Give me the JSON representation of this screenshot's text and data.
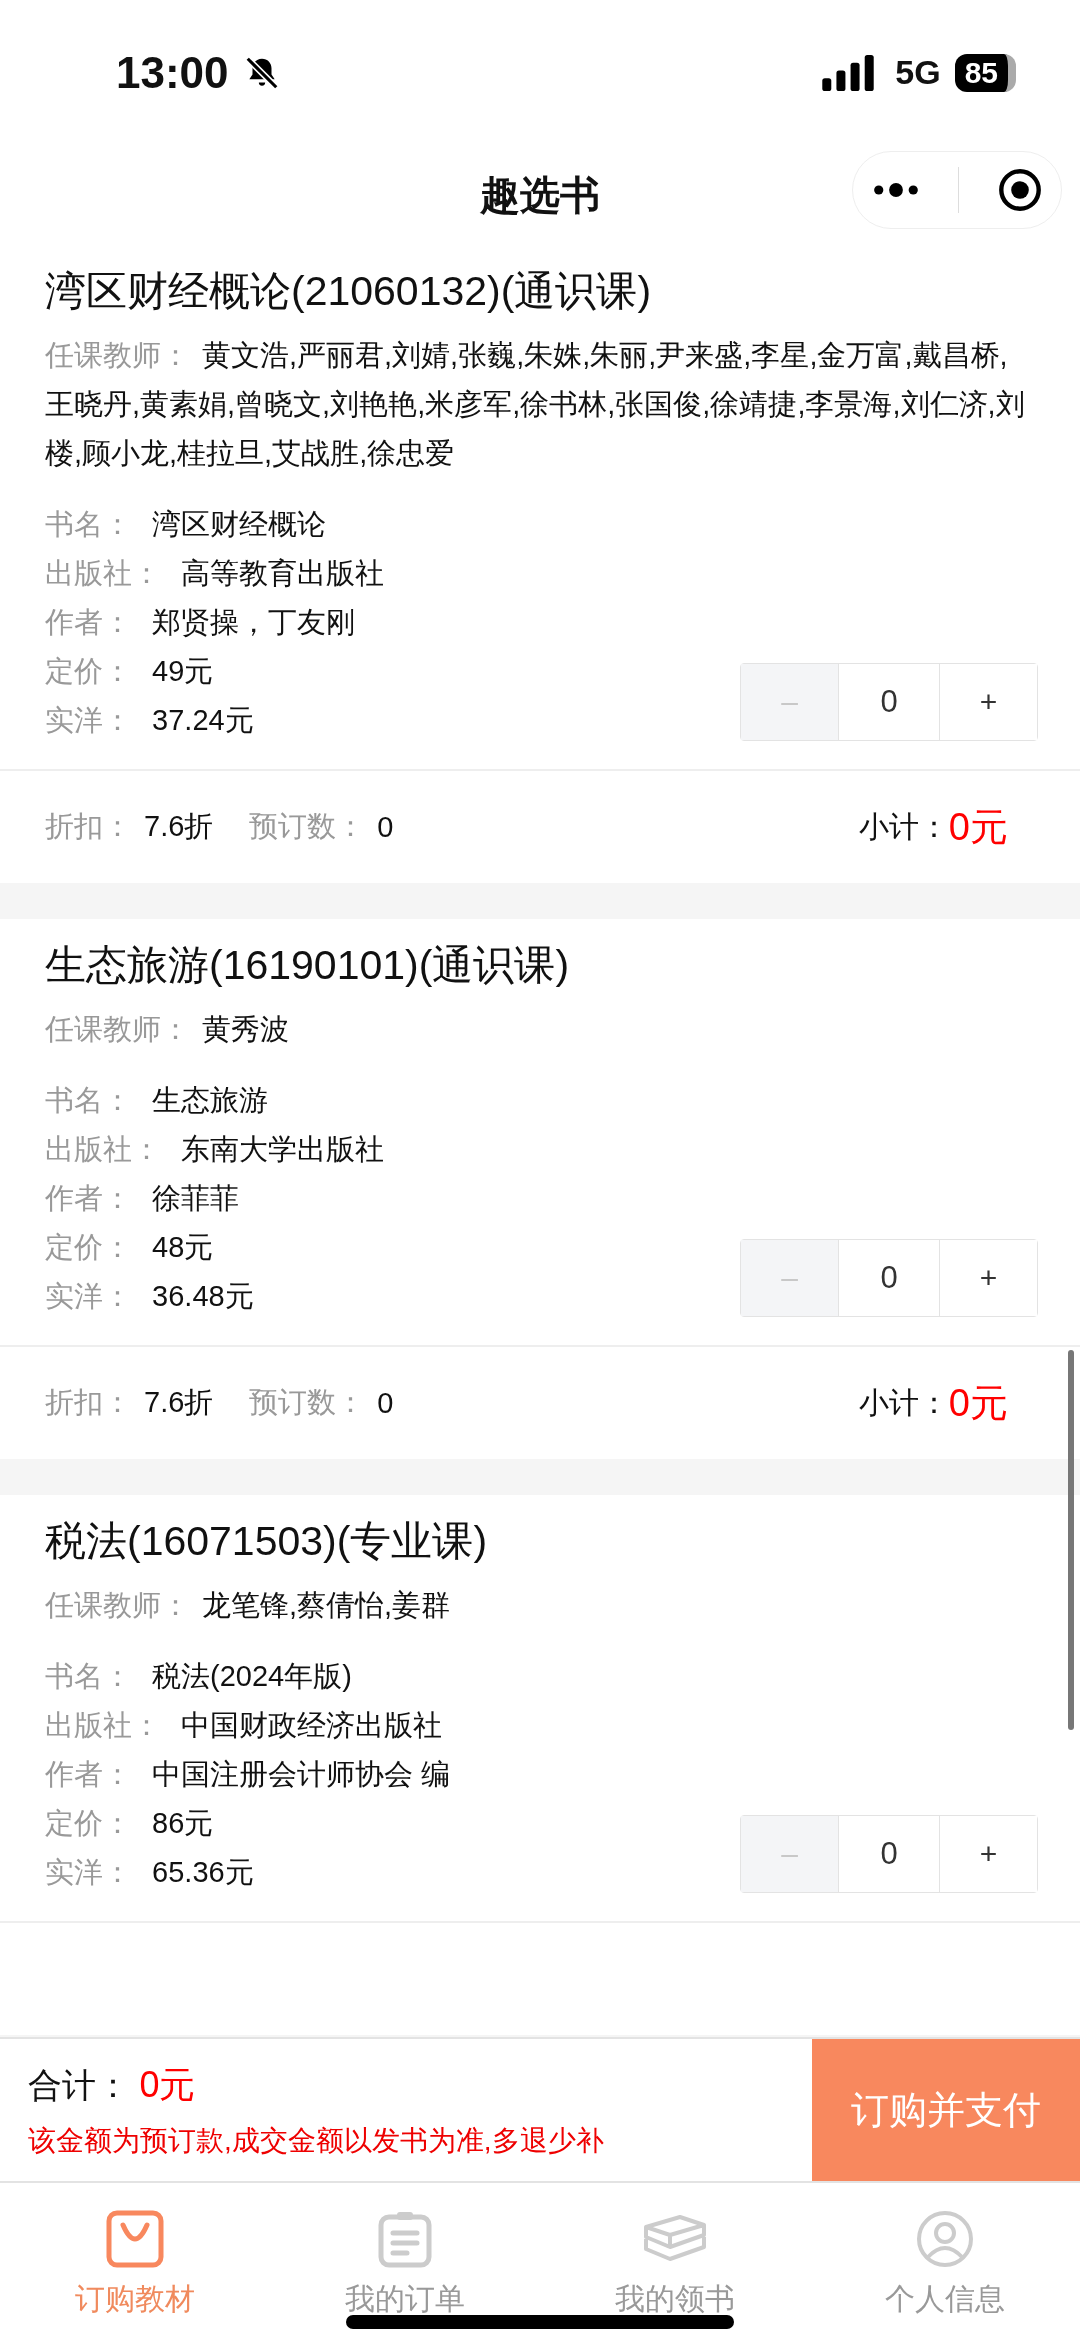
{
  "status_bar": {
    "time": "13:00",
    "network": "5G",
    "battery": "85"
  },
  "nav": {
    "title": "趣选书"
  },
  "courses": [
    {
      "title": "湾区财经概论(21060132)(通识课)",
      "teacher_label": "任课教师：",
      "teachers": "黄文浩,严丽君,刘婧,张巍,朱姝,朱丽,尹来盛,李星,金万富,戴昌桥,王晓丹,黄素娟,曾晓文,刘艳艳,米彦军,徐书林,张国俊,徐靖捷,李景海,刘仁济,刘楼,顾小龙,桂拉旦,艾战胜,徐忠爱",
      "fields": [
        {
          "label": "书名：",
          "value": "湾区财经概论"
        },
        {
          "label": "出版社：",
          "value": "高等教育出版社"
        },
        {
          "label": "作者：",
          "value": "郑贤操，丁友刚"
        },
        {
          "label": "定价：",
          "value": "49元"
        },
        {
          "label": "实洋：",
          "value": "37.24元"
        }
      ],
      "stepper": {
        "minus": "–",
        "value": "0",
        "plus": "+",
        "minus_disabled": true
      },
      "footer": {
        "discount_label": "折扣：",
        "discount": "7.6折",
        "count_label": "预订数：",
        "count": "0",
        "subtotal_label": "小计：",
        "subtotal": "0元"
      }
    },
    {
      "title": "生态旅游(16190101)(通识课)",
      "teacher_label": "任课教师：",
      "teachers": "黄秀波",
      "fields": [
        {
          "label": "书名：",
          "value": "生态旅游"
        },
        {
          "label": "出版社：",
          "value": "东南大学出版社"
        },
        {
          "label": "作者：",
          "value": "徐菲菲"
        },
        {
          "label": "定价：",
          "value": "48元"
        },
        {
          "label": "实洋：",
          "value": "36.48元"
        }
      ],
      "stepper": {
        "minus": "–",
        "value": "0",
        "plus": "+",
        "minus_disabled": true
      },
      "footer": {
        "discount_label": "折扣：",
        "discount": "7.6折",
        "count_label": "预订数：",
        "count": "0",
        "subtotal_label": "小计：",
        "subtotal": "0元"
      }
    },
    {
      "title": "税法(16071503)(专业课)",
      "teacher_label": "任课教师：",
      "teachers": "龙笔锋,蔡倩怡,姜群",
      "fields": [
        {
          "label": "书名：",
          "value": "税法(2024年版)"
        },
        {
          "label": "出版社：",
          "value": "中国财政经济出版社"
        },
        {
          "label": "作者：",
          "value": "中国注册会计师协会 编"
        },
        {
          "label": "定价：",
          "value": "86元"
        },
        {
          "label": "实洋：",
          "value": "65.36元"
        }
      ],
      "stepper": {
        "minus": "–",
        "value": "0",
        "plus": "+",
        "minus_disabled": true
      }
    }
  ],
  "checkout": {
    "total_label": "合计：",
    "total": "0元",
    "notice": "该金额为预订款,成交金额以发书为准,多退少补",
    "pay_button": "订购并支付"
  },
  "tabs": [
    {
      "kind": "bag",
      "label": "订购教材",
      "selected": true
    },
    {
      "kind": "clipboard",
      "label": "我的订单",
      "selected": false
    },
    {
      "kind": "books",
      "label": "我的领书",
      "selected": false
    },
    {
      "kind": "person",
      "label": "个人信息",
      "selected": false
    }
  ]
}
